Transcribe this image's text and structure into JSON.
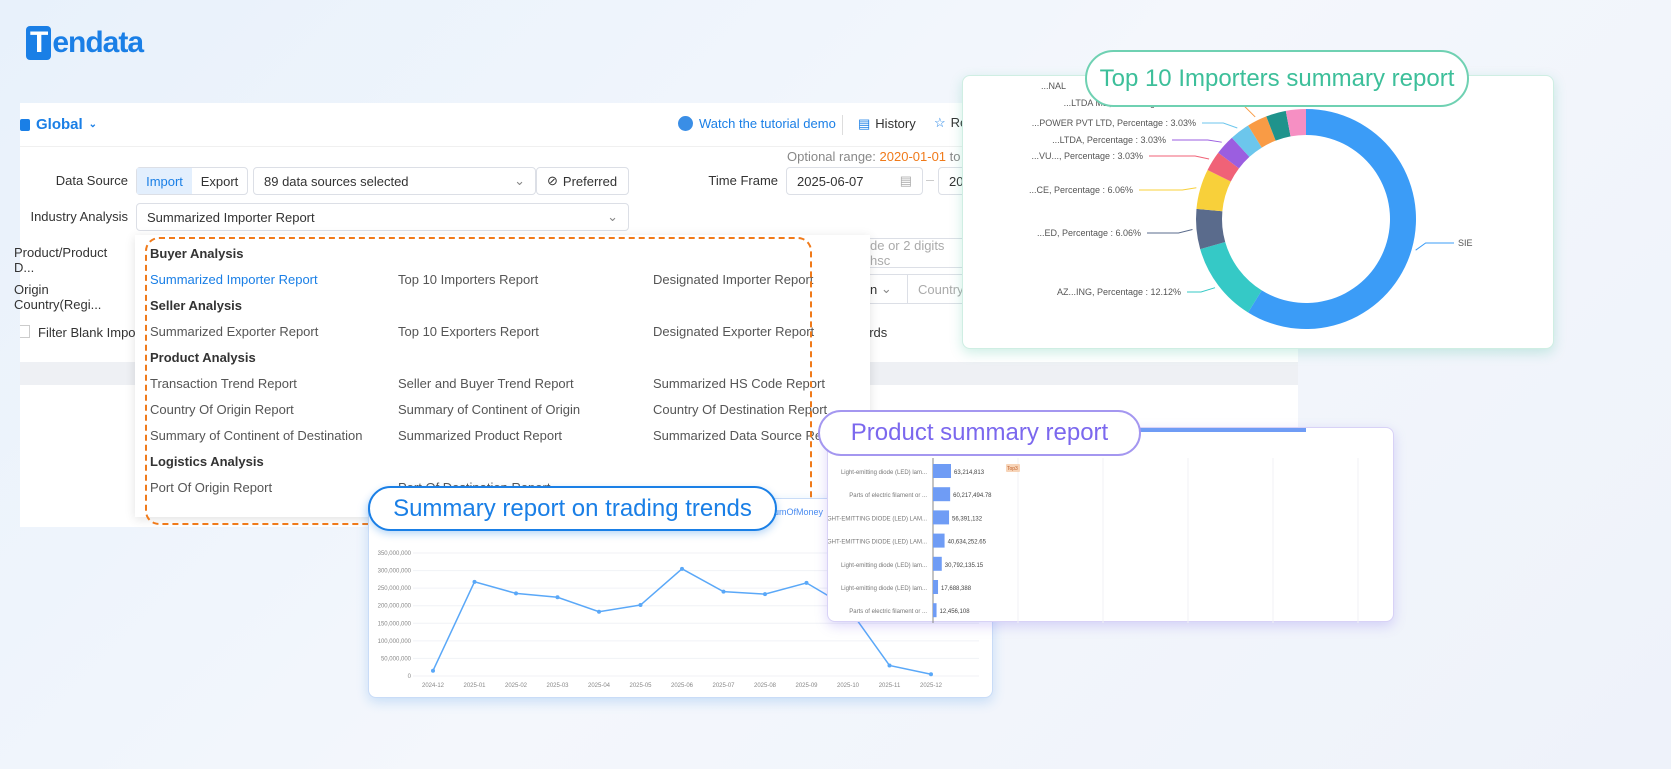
{
  "logo": "Tendata",
  "header": {
    "scope": "Global",
    "tutorial": "Watch the tutorial demo",
    "history": "History",
    "saved": "Re"
  },
  "form": {
    "optional_range_label": "Optional range:",
    "optional_range_value": "2020-01-01",
    "optional_range_to": "to 2",
    "data_source_label": "Data Source",
    "import": "Import",
    "export": "Export",
    "sources": "89 data sources selected",
    "preferred": "Preferred",
    "time_frame_label": "Time Frame",
    "start_date": "2025-06-07",
    "end_date": "202",
    "industry_label": "Industry Analysis",
    "industry_value": "Summarized Importer Report",
    "product_label": "Product/Product D...",
    "product_placeholder": "de or 2 digits hsc",
    "origin_label": "Origin Country(Regi...",
    "origin_select": "n",
    "origin_placeholder": "Country/",
    "filter_label": "Filter Blank Importe",
    "records": "ords"
  },
  "dropdown": {
    "groups": [
      {
        "title": "Buyer Analysis",
        "items": [
          "Summarized Importer Report",
          "Top 10 Importers Report",
          "Designated Importer Report"
        ]
      },
      {
        "title": "Seller Analysis",
        "items": [
          "Summarized Exporter Report",
          "Top 10 Exporters Report",
          "Designated Exporter Report"
        ]
      },
      {
        "title": "Product Analysis",
        "items": [
          "Transaction Trend Report",
          "Seller and Buyer Trend Report",
          "Summarized HS Code Report",
          "Country Of Origin Report",
          "Summary of Continent of Origin",
          "Country Of Destination Report",
          "Summary of Continent of Destination",
          "Summarized Product Report",
          "Summarized Data Source Report"
        ]
      },
      {
        "title": "Logistics Analysis",
        "items": [
          "Port Of Origin Report",
          "Port Of Destination Report"
        ]
      }
    ]
  },
  "colors": {
    "accent": "#1a7fe6",
    "orange": "#f07a1a",
    "green": "#3dbf9a",
    "purple": "#7b68ee"
  },
  "chart_data": [
    {
      "type": "pie",
      "title": "Top 10 Importers summary report",
      "donut": true,
      "slices": [
        {
          "label": "SIE",
          "value": 60.61,
          "color": "#3b9cf7"
        },
        {
          "label": "AZ...ING, Percentage : 12.12%",
          "value": 12.12,
          "color": "#35c9c6"
        },
        {
          "label": "...ED, Percentage : 6.06%",
          "value": 6.06,
          "color": "#5a6b8c"
        },
        {
          "label": "...CE, Percentage : 6.06%",
          "value": 6.06,
          "color": "#f8d03a"
        },
        {
          "label": "...VU..., Percentage : 3.03%",
          "value": 3.03,
          "color": "#f06277"
        },
        {
          "label": "...LTDA, Percentage : 3.03%",
          "value": 3.03,
          "color": "#9b5ee0"
        },
        {
          "label": "...POWER PVT LTD, Percentage : 3.03%",
          "value": 3.03,
          "color": "#6cc6ec"
        },
        {
          "label": "...LTDA ME, Percentage : 3.03%",
          "value": 3.03,
          "color": "#f99b45"
        },
        {
          "label": "...NAL",
          "value": 3.03,
          "color": "#1f938c"
        },
        {
          "label": "",
          "value": 3.03,
          "color": "#f68fc3"
        }
      ]
    },
    {
      "type": "bar",
      "title": "Product summary report",
      "orientation": "horizontal",
      "categories": [
        "Light-emitting diode (LED) lam...",
        "Parts of electric filament or ...",
        "LIGHT-EMITTING DIODE (LED) LAM...",
        "LIGHT-EMITTING DIODE (LED) LAM...",
        "Light-emitting diode (LED) lam...",
        "Light-emitting diode (LED) lam...",
        "Parts of electric filament or ..."
      ],
      "values": [
        63214813,
        60217494.78,
        56391132,
        40634252.65,
        30792135.15,
        17688388,
        12456108
      ],
      "value_labels": [
        "63,214,813",
        "60,217,494.78",
        "56,391,132",
        "40,634,252.65",
        "30,792,135.15",
        "17,688,388",
        "12,456,108"
      ],
      "badge": "Top3",
      "color": "#6f9cf5"
    },
    {
      "type": "line",
      "title": "Summary report on trading trends",
      "legend": "SumOfMoney",
      "x": [
        "2024-12",
        "2025-01",
        "2025-02",
        "2025-03",
        "2025-04",
        "2025-05",
        "2025-06",
        "2025-07",
        "2025-08",
        "2025-09",
        "2025-10",
        "2025-11",
        "2025-12"
      ],
      "values": [
        15000000,
        268000000,
        235000000,
        224000000,
        183000000,
        202000000,
        305000000,
        240000000,
        233000000,
        265000000,
        195000000,
        30000000,
        5000000
      ],
      "ylim": [
        0,
        350000000
      ],
      "yticks": [
        "0",
        "50,000,000",
        "100,000,000",
        "150,000,000",
        "200,000,000",
        "250,000,000",
        "300,000,000",
        "350,000,000"
      ],
      "color": "#5aa8f8"
    }
  ]
}
